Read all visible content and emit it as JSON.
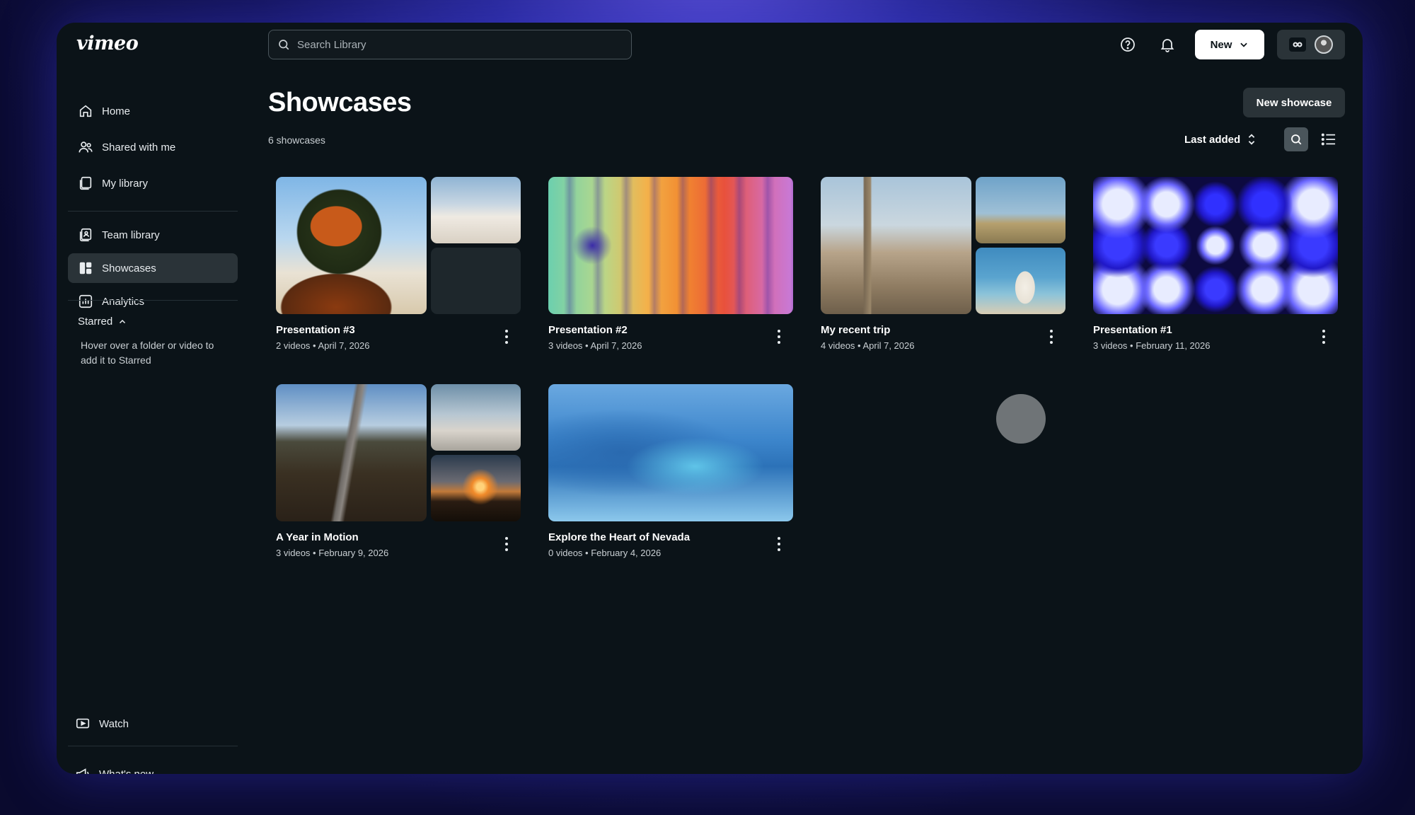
{
  "app": {
    "logo": "vimeo"
  },
  "search": {
    "placeholder": "Search Library"
  },
  "topbar": {
    "new_label": "New"
  },
  "sidebar": {
    "items": [
      {
        "label": "Home",
        "icon": "home-icon"
      },
      {
        "label": "Shared with me",
        "icon": "people-icon"
      },
      {
        "label": "My library",
        "icon": "library-icon"
      },
      {
        "label": "Team library",
        "icon": "team-library-icon"
      },
      {
        "label": "Showcases",
        "icon": "showcase-icon",
        "active": true
      },
      {
        "label": "Analytics",
        "icon": "analytics-icon"
      }
    ],
    "starred_label": "Starred",
    "starred_hint": "Hover over a folder or video to add it to Starred",
    "watch_label": "Watch",
    "whats_new_label": "What's new"
  },
  "main": {
    "title": "Showcases",
    "count": "6 showcases",
    "new_showcase_label": "New showcase",
    "sort_label": "Last added",
    "showcases": [
      {
        "title": "Presentation #3",
        "meta": "2 videos • April 7, 2026"
      },
      {
        "title": "Presentation #2",
        "meta": "3 videos • April 7, 2026"
      },
      {
        "title": "My recent trip",
        "meta": "4 videos • April 7, 2026"
      },
      {
        "title": "Presentation #1",
        "meta": "3 videos • February 11, 2026"
      },
      {
        "title": "A Year in Motion",
        "meta": "3 videos • February 9, 2026"
      },
      {
        "title": "Explore the Heart of Nevada",
        "meta": "0 videos • February 4, 2026"
      }
    ]
  },
  "colors": {
    "window_bg": "#0b1318",
    "active_nav": "#2a3338",
    "accent_button": "#ffffff"
  }
}
